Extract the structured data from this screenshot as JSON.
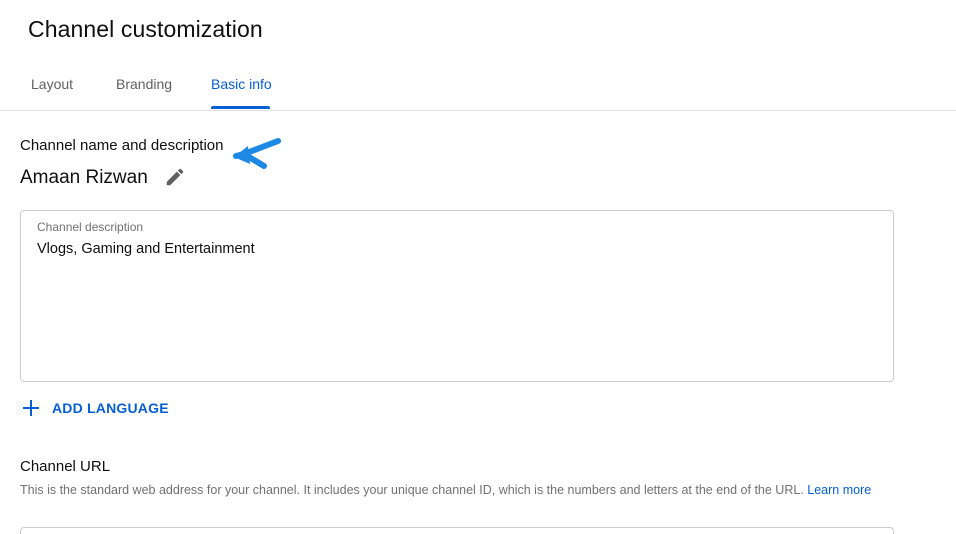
{
  "page": {
    "title": "Channel customization"
  },
  "tabs": [
    {
      "label": "Layout",
      "active": false
    },
    {
      "label": "Branding",
      "active": false
    },
    {
      "label": "Basic info",
      "active": true
    }
  ],
  "basic_info": {
    "section_label": "Channel name and description",
    "channel_name": "Amaan Rizwan",
    "description_field": {
      "label": "Channel description",
      "value": "Vlogs, Gaming and Entertainment"
    },
    "add_language_label": "ADD LANGUAGE",
    "url_section": {
      "heading": "Channel URL",
      "description": "This is the standard web address for your channel. It includes your unique channel ID, which is the numbers and letters at the end of the URL.",
      "learn_more": "Learn more"
    }
  },
  "icons": {
    "edit": "pencil-icon",
    "add": "plus-icon",
    "annotation": "arrow-icon"
  },
  "colors": {
    "accent": "#065fd4",
    "annotation_arrow": "#1e88e5",
    "text_primary": "#0f0f0f",
    "text_secondary": "#606060"
  }
}
